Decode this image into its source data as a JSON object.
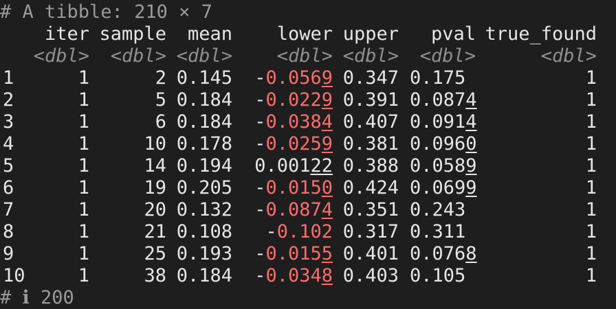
{
  "console": {
    "header": "# A tibble: 210 × 7",
    "footer_partial": "# ℹ 200"
  },
  "table": {
    "columns": [
      "iter",
      "sample",
      "mean",
      "lower",
      "upper",
      "pval",
      "true_found"
    ],
    "types": [
      "<dbl>",
      "<dbl>",
      "<dbl>",
      "<dbl>",
      "<dbl>",
      "<dbl>",
      "<dbl>"
    ],
    "rows": [
      {
        "id": "1",
        "iter": "1",
        "sample": "2",
        "mean": "0.145",
        "lower_sign": "-",
        "lower_main": "0.056",
        "lower_under": "9",
        "lower_neg": true,
        "upper": "0.347",
        "pval_main": "0.175",
        "pval_under": "",
        "true_found": "1"
      },
      {
        "id": "2",
        "iter": "1",
        "sample": "5",
        "mean": "0.184",
        "lower_sign": "-",
        "lower_main": "0.022",
        "lower_under": "9",
        "lower_neg": true,
        "upper": "0.391",
        "pval_main": "0.087",
        "pval_under": "4",
        "true_found": "1"
      },
      {
        "id": "3",
        "iter": "1",
        "sample": "6",
        "mean": "0.184",
        "lower_sign": "-",
        "lower_main": "0.038",
        "lower_under": "4",
        "lower_neg": true,
        "upper": "0.407",
        "pval_main": "0.091",
        "pval_under": "4",
        "true_found": "1"
      },
      {
        "id": "4",
        "iter": "1",
        "sample": "10",
        "mean": "0.178",
        "lower_sign": "-",
        "lower_main": "0.025",
        "lower_under": "9",
        "lower_neg": true,
        "upper": "0.381",
        "pval_main": "0.096",
        "pval_under": "0",
        "true_found": "1"
      },
      {
        "id": "5",
        "iter": "1",
        "sample": "14",
        "mean": "0.194",
        "lower_sign": " ",
        "lower_main": "0.001",
        "lower_under": "22",
        "lower_neg": false,
        "upper": "0.388",
        "pval_main": "0.058",
        "pval_under": "9",
        "true_found": "1"
      },
      {
        "id": "6",
        "iter": "1",
        "sample": "19",
        "mean": "0.205",
        "lower_sign": "-",
        "lower_main": "0.015",
        "lower_under": "0",
        "lower_neg": true,
        "upper": "0.424",
        "pval_main": "0.069",
        "pval_under": "9",
        "true_found": "1"
      },
      {
        "id": "7",
        "iter": "1",
        "sample": "20",
        "mean": "0.132",
        "lower_sign": "-",
        "lower_main": "0.087",
        "lower_under": "4",
        "lower_neg": true,
        "upper": "0.351",
        "pval_main": "0.243",
        "pval_under": "",
        "true_found": "1"
      },
      {
        "id": "8",
        "iter": "1",
        "sample": "21",
        "mean": "0.108",
        "lower_sign": "-",
        "lower_main": "0.102",
        "lower_under": "",
        "lower_neg": true,
        "upper": "0.317",
        "pval_main": "0.311",
        "pval_under": "",
        "true_found": "1"
      },
      {
        "id": "9",
        "iter": "1",
        "sample": "25",
        "mean": "0.193",
        "lower_sign": "-",
        "lower_main": "0.015",
        "lower_under": "5",
        "lower_neg": true,
        "upper": "0.401",
        "pval_main": "0.076",
        "pval_under": "8",
        "true_found": "1"
      },
      {
        "id": "10",
        "iter": "1",
        "sample": "38",
        "mean": "0.184",
        "lower_sign": "-",
        "lower_main": "0.034",
        "lower_under": "8",
        "lower_neg": true,
        "upper": "0.403",
        "pval_main": "0.105",
        "pval_under": "",
        "true_found": "1"
      }
    ]
  },
  "colors": {
    "background": "#1e1e1e",
    "text": "#e6e6e6",
    "comment": "#9a9a9a",
    "type": "#8f8f8f",
    "negative": "#ff6b6b"
  }
}
